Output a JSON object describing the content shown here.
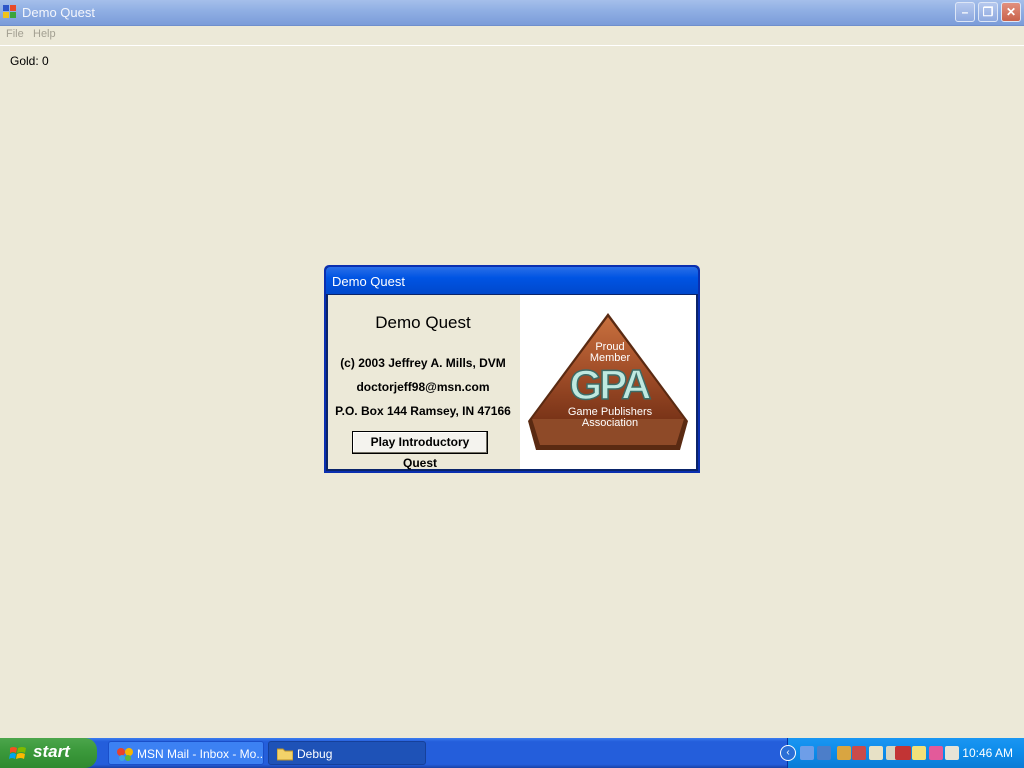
{
  "window": {
    "title": "Demo Quest"
  },
  "menu": {
    "items": [
      "File",
      "Help"
    ]
  },
  "status": {
    "gold_label": "Gold: 0"
  },
  "dialog": {
    "title": "Demo Quest",
    "heading": "Demo Quest",
    "copyright": "(c) 2003 Jeffrey A. Mills, DVM",
    "email": "doctorjeff98@msn.com",
    "address": "P.O. Box 144 Ramsey, IN 47166",
    "play_button": "Play Introductory Quest",
    "logo": {
      "top_text_1": "Proud",
      "top_text_2": "Member",
      "acronym": "GPA",
      "bottom_text_1": "Game Publishers",
      "bottom_text_2": "Association"
    }
  },
  "taskbar": {
    "start_label": "start",
    "tasks": [
      {
        "label": "MSN Mail - Inbox - Mo...",
        "icon": "msn-butterfly-icon",
        "active": false
      },
      {
        "label": "Debug",
        "icon": "folder-icon",
        "active": true
      }
    ],
    "clock": "10:46 AM"
  },
  "colors": {
    "desktop_bg": "#ECE9D8",
    "taskbar_blue": "#245EDB",
    "start_green": "#3C9A3C",
    "dialog_title_blue": "#0054E3"
  }
}
